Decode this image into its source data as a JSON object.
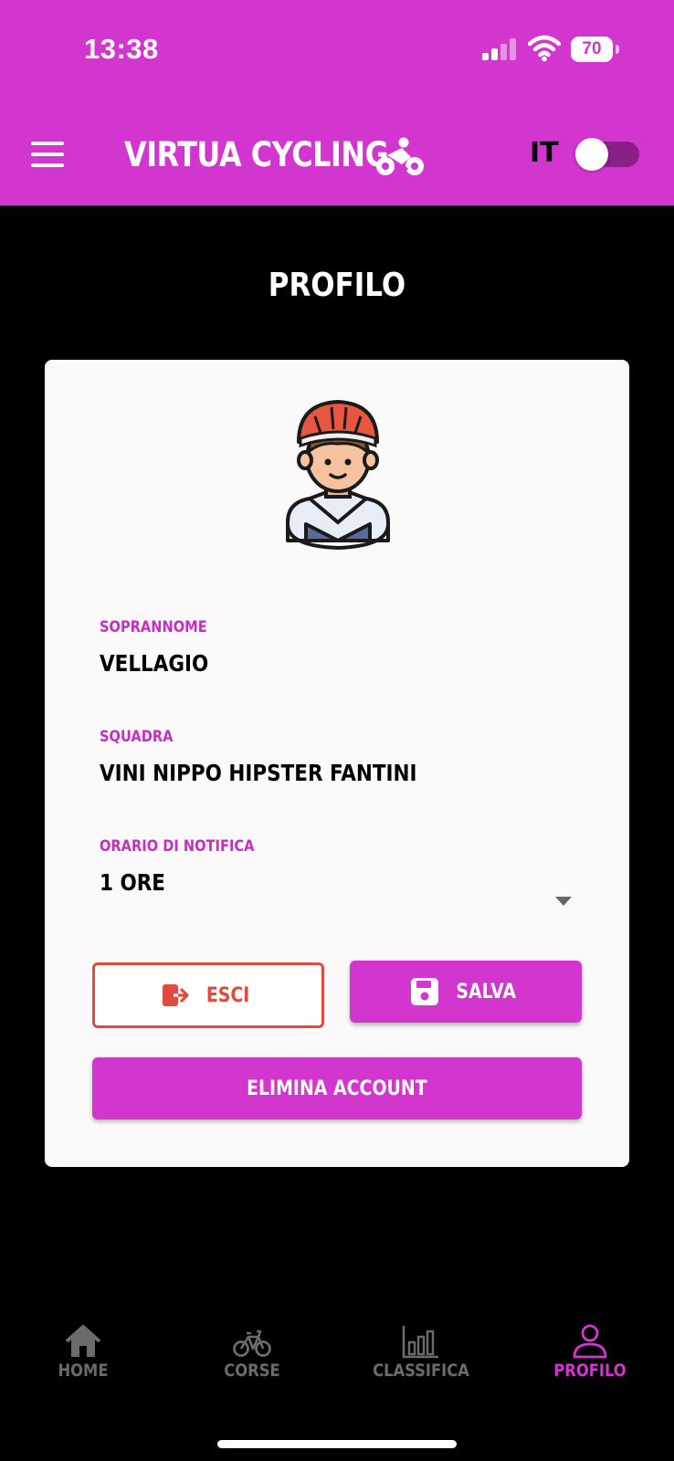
{
  "status_bar": {
    "time": "13:38",
    "battery": "70"
  },
  "header": {
    "title": "Virtua Cycling",
    "language": "IT",
    "language_toggle_on": false
  },
  "page": {
    "title": "Profilo"
  },
  "profile": {
    "nickname_label": "Soprannome",
    "nickname_value": "Vellagio",
    "team_label": "Squadra",
    "team_value": "Vini Nippo Hipster Fantini",
    "notification_label": "Orario di notifica",
    "notification_value": "1 ore"
  },
  "buttons": {
    "exit": "Esci",
    "save": "Salva",
    "delete_account": "Elimina Account"
  },
  "nav": {
    "items": [
      {
        "label": "Home",
        "icon": "home-icon",
        "active": false
      },
      {
        "label": "Corse",
        "icon": "bicycle-icon",
        "active": false
      },
      {
        "label": "Classifica",
        "icon": "bar-chart-icon",
        "active": false
      },
      {
        "label": "Profilo",
        "icon": "user-icon",
        "active": true
      }
    ]
  },
  "colors": {
    "brand": "#d335cf",
    "exit_red": "#e04b3f",
    "nav_inactive": "#6b6b6b",
    "background": "#000000"
  }
}
